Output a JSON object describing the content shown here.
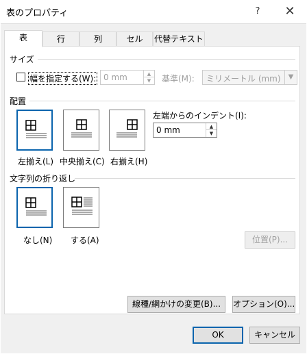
{
  "window": {
    "title": "表のプロパティ",
    "help_glyph": "?",
    "close_glyph": "✕"
  },
  "tabs": [
    {
      "label": "表",
      "active": true
    },
    {
      "label": "行",
      "active": false
    },
    {
      "label": "列",
      "active": false
    },
    {
      "label": "セル",
      "active": false
    },
    {
      "label": "代替テキスト",
      "active": false
    }
  ],
  "size": {
    "section_label": "サイズ",
    "width_checkbox_label": "幅を指定する(W):",
    "width_value": "0 mm",
    "basis_label": "基準(M):",
    "basis_value": "ミリメートル (mm)"
  },
  "alignment": {
    "section_label": "配置",
    "options": [
      {
        "label": "左揃え(L)",
        "selected": true
      },
      {
        "label": "中央揃え(C)",
        "selected": false
      },
      {
        "label": "右揃え(H)",
        "selected": false
      }
    ],
    "indent_label": "左端からのインデント(I):",
    "indent_value": "0 mm"
  },
  "wrapping": {
    "section_label": "文字列の折り返し",
    "options": [
      {
        "label": "なし(N)",
        "selected": true
      },
      {
        "label": "する(A)",
        "selected": false
      }
    ],
    "position_button": "位置(P)..."
  },
  "buttons": {
    "borders_shading": "線種/網かけの変更(B)...",
    "options": "オプション(O)...",
    "ok": "OK",
    "cancel": "キャンセル"
  },
  "colors": {
    "accent": "#0a64ad",
    "disabled": "#a0a0a0",
    "dialog_bg": "#f0f0f0"
  }
}
